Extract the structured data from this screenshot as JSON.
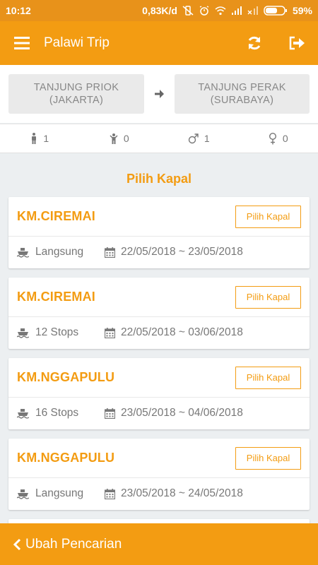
{
  "status_bar": {
    "time": "10:12",
    "speed": "0,83K/d",
    "battery": "59%"
  },
  "app": {
    "title": "Palawi Trip",
    "accent": "#f39c12"
  },
  "route": {
    "origin_line1": "TANJUNG PRIOK",
    "origin_line2": "(JAKARTA)",
    "destination_line1": "TANJUNG PERAK",
    "destination_line2": "(SURABAYA)"
  },
  "passengers": {
    "adult": "1",
    "infant": "0",
    "male": "1",
    "female": "0"
  },
  "section_title": "Pilih Kapal",
  "ships": [
    {
      "name": "KM.CIREMAI",
      "button": "Pilih Kapal",
      "stops": "Langsung",
      "dates": "22/05/2018 ~ 23/05/2018"
    },
    {
      "name": "KM.CIREMAI",
      "button": "Pilih Kapal",
      "stops": "12 Stops",
      "dates": "22/05/2018 ~ 03/06/2018"
    },
    {
      "name": "KM.NGGAPULU",
      "button": "Pilih Kapal",
      "stops": "16 Stops",
      "dates": "23/05/2018 ~ 04/06/2018"
    },
    {
      "name": "KM.NGGAPULU",
      "button": "Pilih Kapal",
      "stops": "Langsung",
      "dates": "23/05/2018 ~ 24/05/2018"
    }
  ],
  "bottom": {
    "label": "Ubah Pencarian"
  }
}
